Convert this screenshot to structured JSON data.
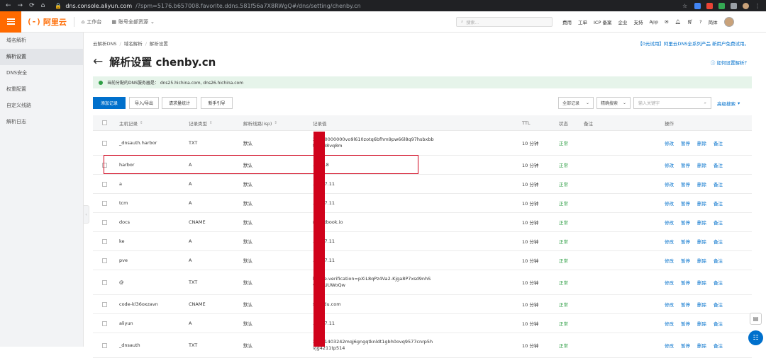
{
  "browser": {
    "url_main": "dns.console.aliyun.com",
    "url_rest": "/?spm=5176.b657008.favorite.ddns.581f56a7X8RWgQ#/dns/setting/chenby.cn"
  },
  "topbar": {
    "logo_text": "阿里云",
    "workbench": "工作台",
    "account_scope": "账号全部资源",
    "search_placeholder": "搜索...",
    "links": [
      "费用",
      "工单",
      "ICP 备案",
      "企业",
      "支持",
      "App"
    ],
    "lang": "简体"
  },
  "sidebar": {
    "items": [
      {
        "label": "域名解析"
      },
      {
        "label": "解析设置"
      },
      {
        "label": "DNS安全"
      },
      {
        "label": "权重配置"
      },
      {
        "label": "自定义线路"
      },
      {
        "label": "解析日志"
      }
    ]
  },
  "breadcrumb": [
    "云解析DNS",
    "域名解析",
    "解析设置"
  ],
  "promo": "【0元试用】阿里云DNS全系列产品 新用户免费试用。",
  "page_title": "解析设置 chenby.cn",
  "help_link": "如何设置解析？",
  "notice": "当前分配的DNS服务器是： dns25.hichina.com, dns26.hichina.com",
  "toolbar": {
    "add": "添加记录",
    "import_export": "导入/导出",
    "stats": "请求量统计",
    "guide": "新手引导",
    "filter_all": "全部记录",
    "exact_search": "精确搜索",
    "keyword_placeholder": "输入关键字",
    "advanced": "高级搜索"
  },
  "table": {
    "headers": {
      "host": "主机记录",
      "type": "记录类型",
      "line": "解析线路(isp)",
      "value": "记录值",
      "ttl": "TTL",
      "status": "状态",
      "remark": "备注",
      "ops": "操作"
    },
    "ops": [
      "修改",
      "暂停",
      "删除",
      "备注"
    ],
    "rows": [
      {
        "host": "_dnsauth.harbor",
        "type": "TXT",
        "line": "默认",
        "value": "20250000000vo9l610zotq6bfhm9pw66l8q97hsbxbb\nt4uh98vq8m",
        "ttl": "10 分钟",
        "status": "正常"
      },
      {
        "host": "harbor",
        "type": "A",
        "line": "默认",
        "value": ".68.1.8",
        "ttl": "10 分钟",
        "status": "正常"
      },
      {
        "host": "a",
        "type": "A",
        "line": "默认",
        "value": ".6.237.11",
        "ttl": "10 分钟",
        "status": "正常"
      },
      {
        "host": "tcm",
        "type": "A",
        "line": "默认",
        "value": ".6.237.11",
        "ttl": "10 分钟",
        "status": "正常"
      },
      {
        "host": "docs",
        "type": "CNAME",
        "line": "默认",
        "value": "ng.gitbook.io",
        "ttl": "10 分钟",
        "status": "正常"
      },
      {
        "host": "ke",
        "type": "A",
        "line": "默认",
        "value": ".6.237.11",
        "ttl": "10 分钟",
        "status": "正常"
      },
      {
        "host": "pve",
        "type": "A",
        "line": "默认",
        "value": ".6.237.11",
        "ttl": "10 分钟",
        "status": "正常"
      },
      {
        "host": "@",
        "type": "TXT",
        "line": "默认",
        "value": "le-site-verification=pXiL8qPz4Va2-Kjga8P7xsd9nhS\nvyngUUWoQw",
        "ttl": "10 分钟",
        "status": "正常"
      },
      {
        "host": "code-kl36oxzavn",
        "type": "CNAME",
        "line": "默认",
        "value": "s.baidu.com",
        "ttl": "10 分钟",
        "status": "正常"
      },
      {
        "host": "aliyun",
        "type": "A",
        "line": "默认",
        "value": ".6.237.11",
        "ttl": "10 分钟",
        "status": "正常"
      },
      {
        "host": "_dnsauth",
        "type": "TXT",
        "line": "默认",
        "value": "20021403242mqj6gngqtknldt1gbh0ovq9577cnrp5h\nvjg4211tp514",
        "ttl": "10 分钟",
        "status": "正常"
      }
    ]
  },
  "colors": {
    "brand": "#ff6a00",
    "primary": "#0070cc",
    "ok": "#2e9e44",
    "annotation": "#d0021b"
  }
}
